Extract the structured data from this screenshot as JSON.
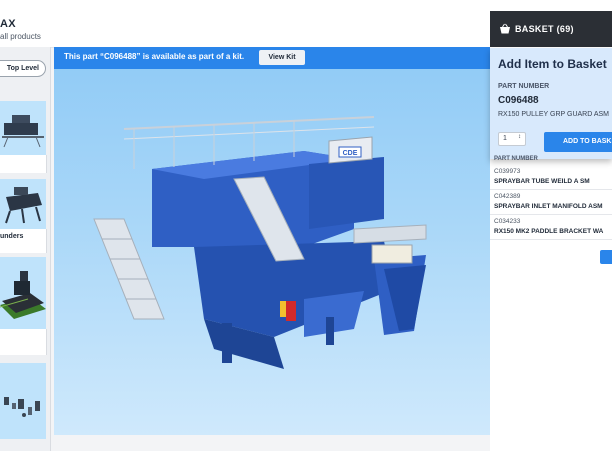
{
  "header": {
    "title": "AX",
    "subtitle": "all products"
  },
  "sidebar": {
    "top_level_label": "Top Level",
    "items": [
      {
        "label": ""
      },
      {
        "label": "unders"
      },
      {
        "label": ""
      },
      {
        "label": ""
      }
    ]
  },
  "banner": {
    "text": "This part “C096488” is available as part of a kit.",
    "view_kit_label": "View Kit"
  },
  "viewer": {
    "logo_text": "CDE"
  },
  "basket": {
    "title": "BASKET (69)",
    "icon": "basket-icon"
  },
  "popup": {
    "title": "Add Item to Basket",
    "part_number_label": "PART NUMBER",
    "part_number": "C096488",
    "description": "RX150 PULLEY GRP GUARD ASM",
    "quantity": "1",
    "add_label": "ADD TO BASKET"
  },
  "basket_list": {
    "header": "PART NUMBER",
    "items": [
      {
        "pn": "C039973",
        "desc": "SPRAYBAR TUBE WEILD A SM"
      },
      {
        "pn": "C042389",
        "desc": "SPRAYBAR INLET MANIFOLD ASM"
      },
      {
        "pn": "C034233",
        "desc": "RX150 MK2 PADDLE BRACKET WA"
      }
    ]
  },
  "colors": {
    "accent": "#2a85ea",
    "header_dark": "#2b2f35",
    "popup_bg": "#d8e9fc",
    "machine_blue": "#2f5fc4"
  }
}
